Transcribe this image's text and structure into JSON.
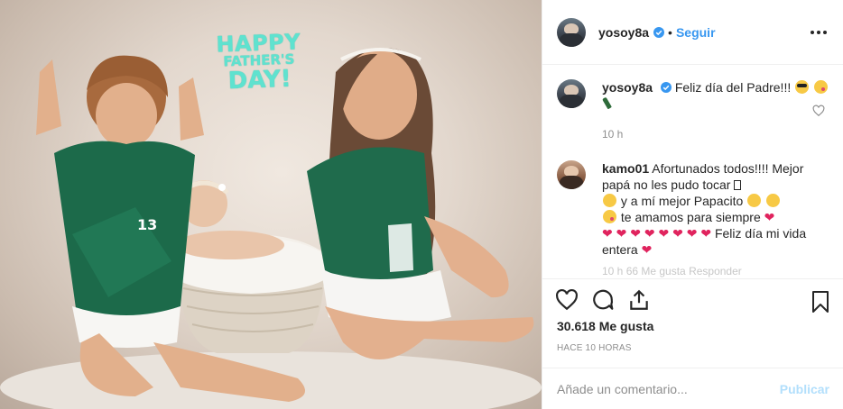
{
  "photo": {
    "overlay_text": {
      "line1": "HAPPY",
      "line2": "FATHER'S",
      "line3": "DAY!"
    },
    "jersey_number": "13"
  },
  "header": {
    "username": "yosoy8a",
    "verified": true,
    "separator": "•",
    "follow_label": "Seguir"
  },
  "caption": {
    "username": "yosoy8a",
    "text": "Feliz día del Padre!!!",
    "time": "10 h"
  },
  "comments": [
    {
      "username": "kamo01",
      "text_1": "Afortunados todos!!!! Mejor papá no les pudo tocar",
      "text_2": "y a mí mejor Papacito",
      "text_3": "te amamos para siempre",
      "text_4": "Feliz día mi vida entera",
      "faded_meta": "10 h   66 Me gusta   Responder"
    }
  ],
  "actions": {
    "like_icon": "heart-icon",
    "comment_icon": "comment-icon",
    "share_icon": "share-icon",
    "save_icon": "bookmark-icon"
  },
  "likes_text": "30.618 Me gusta",
  "time_ago": "HACE 10 HORAS",
  "comment_box": {
    "placeholder": "Añade un comentario...",
    "publish_label": "Publicar"
  },
  "colors": {
    "link_blue": "#3897f0",
    "publish_disabled": "#b2dffc",
    "heart_red": "#e0245e",
    "overlay_teal": "#5fe2cf"
  }
}
